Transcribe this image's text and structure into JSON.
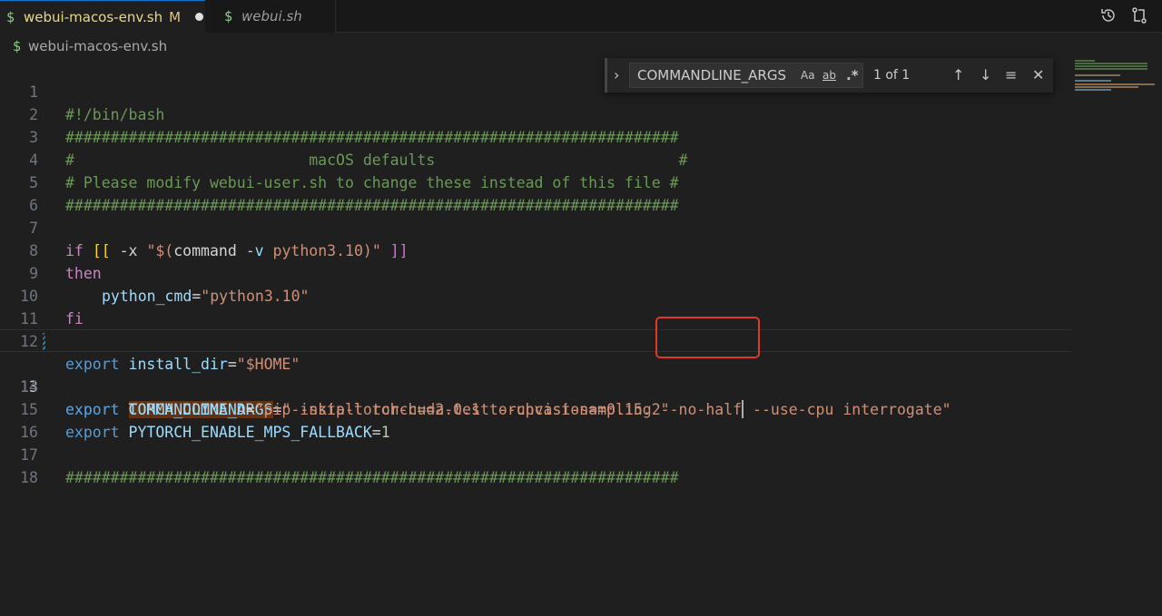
{
  "tabs": [
    {
      "icon": "$",
      "name": "webui-macos-env.sh",
      "status": "M",
      "active": true
    },
    {
      "icon": "$",
      "name": "webui.sh",
      "active": false
    }
  ],
  "breadcrumb": {
    "icon": "$",
    "file": "webui-macos-env.sh"
  },
  "find": {
    "query": "COMMANDLINE_ARGS",
    "match_case": "Aa",
    "whole_word": "ab",
    "regex": ".*",
    "result_count": "1 of 1"
  },
  "editor": {
    "current_line": 13,
    "line_numbers": [
      "1",
      "2",
      "3",
      "4",
      "5",
      "6",
      "7",
      "8",
      "9",
      "10",
      "11",
      "12",
      "13",
      "14",
      "15",
      "16",
      "17",
      "18"
    ],
    "l1": "#!/bin/bash",
    "l2": "####################################################################",
    "l3": "#                          macOS defaults                           #",
    "l4": "# Please modify webui-user.sh to change these instead of this file #",
    "l5": "####################################################################",
    "l7": {
      "if": "if",
      "open": "[[",
      "flag": " -x ",
      "q1": "\"$(",
      "cmd": "command",
      "opt": " -v ",
      "arg": "python3.10",
      "q2": ")\"",
      "close": "]]"
    },
    "l8": "then",
    "l9": {
      "var": "python_cmd",
      "eq": "=",
      "val": "\"python3.10\""
    },
    "l10": "fi",
    "l12": {
      "kw": "export",
      "var": "install_dir",
      "eq": "=",
      "val": "\"$HOME\""
    },
    "l13": {
      "kw": "export",
      "var": "COMMANDLINE_ARGS",
      "eq": "=",
      "val_a": "\"--skip-torch-cuda-test --upcast-sampling --no-half",
      "val_b": " --use-cpu interrogate\""
    },
    "l14": {
      "kw": "export",
      "var": "TORCH_COMMAND",
      "eq": "=",
      "val": "\"pip install torch==2.0.1 torchvision==0.15.2\""
    },
    "l15": {
      "kw": "export",
      "var": "PYTORCH_ENABLE_MPS_FALLBACK",
      "eq": "=",
      "val": "1"
    },
    "l17": "####################################################################"
  },
  "colors": {
    "accent": "#0078d4",
    "annotation": "#e03a25",
    "comment": "#6a9955",
    "string": "#ce9178",
    "variable": "#9cdcfe",
    "keyword": "#c586c0"
  }
}
